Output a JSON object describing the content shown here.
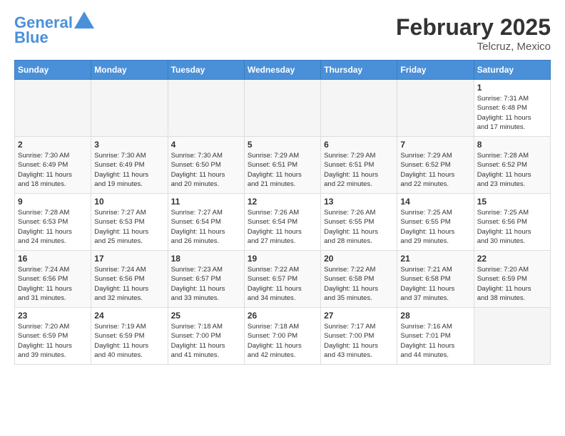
{
  "header": {
    "logo_line1": "General",
    "logo_line2": "Blue",
    "month_title": "February 2025",
    "location": "Telcruz, Mexico"
  },
  "weekdays": [
    "Sunday",
    "Monday",
    "Tuesday",
    "Wednesday",
    "Thursday",
    "Friday",
    "Saturday"
  ],
  "weeks": [
    [
      {
        "day": "",
        "info": ""
      },
      {
        "day": "",
        "info": ""
      },
      {
        "day": "",
        "info": ""
      },
      {
        "day": "",
        "info": ""
      },
      {
        "day": "",
        "info": ""
      },
      {
        "day": "",
        "info": ""
      },
      {
        "day": "1",
        "info": "Sunrise: 7:31 AM\nSunset: 6:48 PM\nDaylight: 11 hours\nand 17 minutes."
      }
    ],
    [
      {
        "day": "2",
        "info": "Sunrise: 7:30 AM\nSunset: 6:49 PM\nDaylight: 11 hours\nand 18 minutes."
      },
      {
        "day": "3",
        "info": "Sunrise: 7:30 AM\nSunset: 6:49 PM\nDaylight: 11 hours\nand 19 minutes."
      },
      {
        "day": "4",
        "info": "Sunrise: 7:30 AM\nSunset: 6:50 PM\nDaylight: 11 hours\nand 20 minutes."
      },
      {
        "day": "5",
        "info": "Sunrise: 7:29 AM\nSunset: 6:51 PM\nDaylight: 11 hours\nand 21 minutes."
      },
      {
        "day": "6",
        "info": "Sunrise: 7:29 AM\nSunset: 6:51 PM\nDaylight: 11 hours\nand 22 minutes."
      },
      {
        "day": "7",
        "info": "Sunrise: 7:29 AM\nSunset: 6:52 PM\nDaylight: 11 hours\nand 22 minutes."
      },
      {
        "day": "8",
        "info": "Sunrise: 7:28 AM\nSunset: 6:52 PM\nDaylight: 11 hours\nand 23 minutes."
      }
    ],
    [
      {
        "day": "9",
        "info": "Sunrise: 7:28 AM\nSunset: 6:53 PM\nDaylight: 11 hours\nand 24 minutes."
      },
      {
        "day": "10",
        "info": "Sunrise: 7:27 AM\nSunset: 6:53 PM\nDaylight: 11 hours\nand 25 minutes."
      },
      {
        "day": "11",
        "info": "Sunrise: 7:27 AM\nSunset: 6:54 PM\nDaylight: 11 hours\nand 26 minutes."
      },
      {
        "day": "12",
        "info": "Sunrise: 7:26 AM\nSunset: 6:54 PM\nDaylight: 11 hours\nand 27 minutes."
      },
      {
        "day": "13",
        "info": "Sunrise: 7:26 AM\nSunset: 6:55 PM\nDaylight: 11 hours\nand 28 minutes."
      },
      {
        "day": "14",
        "info": "Sunrise: 7:25 AM\nSunset: 6:55 PM\nDaylight: 11 hours\nand 29 minutes."
      },
      {
        "day": "15",
        "info": "Sunrise: 7:25 AM\nSunset: 6:56 PM\nDaylight: 11 hours\nand 30 minutes."
      }
    ],
    [
      {
        "day": "16",
        "info": "Sunrise: 7:24 AM\nSunset: 6:56 PM\nDaylight: 11 hours\nand 31 minutes."
      },
      {
        "day": "17",
        "info": "Sunrise: 7:24 AM\nSunset: 6:56 PM\nDaylight: 11 hours\nand 32 minutes."
      },
      {
        "day": "18",
        "info": "Sunrise: 7:23 AM\nSunset: 6:57 PM\nDaylight: 11 hours\nand 33 minutes."
      },
      {
        "day": "19",
        "info": "Sunrise: 7:22 AM\nSunset: 6:57 PM\nDaylight: 11 hours\nand 34 minutes."
      },
      {
        "day": "20",
        "info": "Sunrise: 7:22 AM\nSunset: 6:58 PM\nDaylight: 11 hours\nand 35 minutes."
      },
      {
        "day": "21",
        "info": "Sunrise: 7:21 AM\nSunset: 6:58 PM\nDaylight: 11 hours\nand 37 minutes."
      },
      {
        "day": "22",
        "info": "Sunrise: 7:20 AM\nSunset: 6:59 PM\nDaylight: 11 hours\nand 38 minutes."
      }
    ],
    [
      {
        "day": "23",
        "info": "Sunrise: 7:20 AM\nSunset: 6:59 PM\nDaylight: 11 hours\nand 39 minutes."
      },
      {
        "day": "24",
        "info": "Sunrise: 7:19 AM\nSunset: 6:59 PM\nDaylight: 11 hours\nand 40 minutes."
      },
      {
        "day": "25",
        "info": "Sunrise: 7:18 AM\nSunset: 7:00 PM\nDaylight: 11 hours\nand 41 minutes."
      },
      {
        "day": "26",
        "info": "Sunrise: 7:18 AM\nSunset: 7:00 PM\nDaylight: 11 hours\nand 42 minutes."
      },
      {
        "day": "27",
        "info": "Sunrise: 7:17 AM\nSunset: 7:00 PM\nDaylight: 11 hours\nand 43 minutes."
      },
      {
        "day": "28",
        "info": "Sunrise: 7:16 AM\nSunset: 7:01 PM\nDaylight: 11 hours\nand 44 minutes."
      },
      {
        "day": "",
        "info": ""
      }
    ]
  ]
}
